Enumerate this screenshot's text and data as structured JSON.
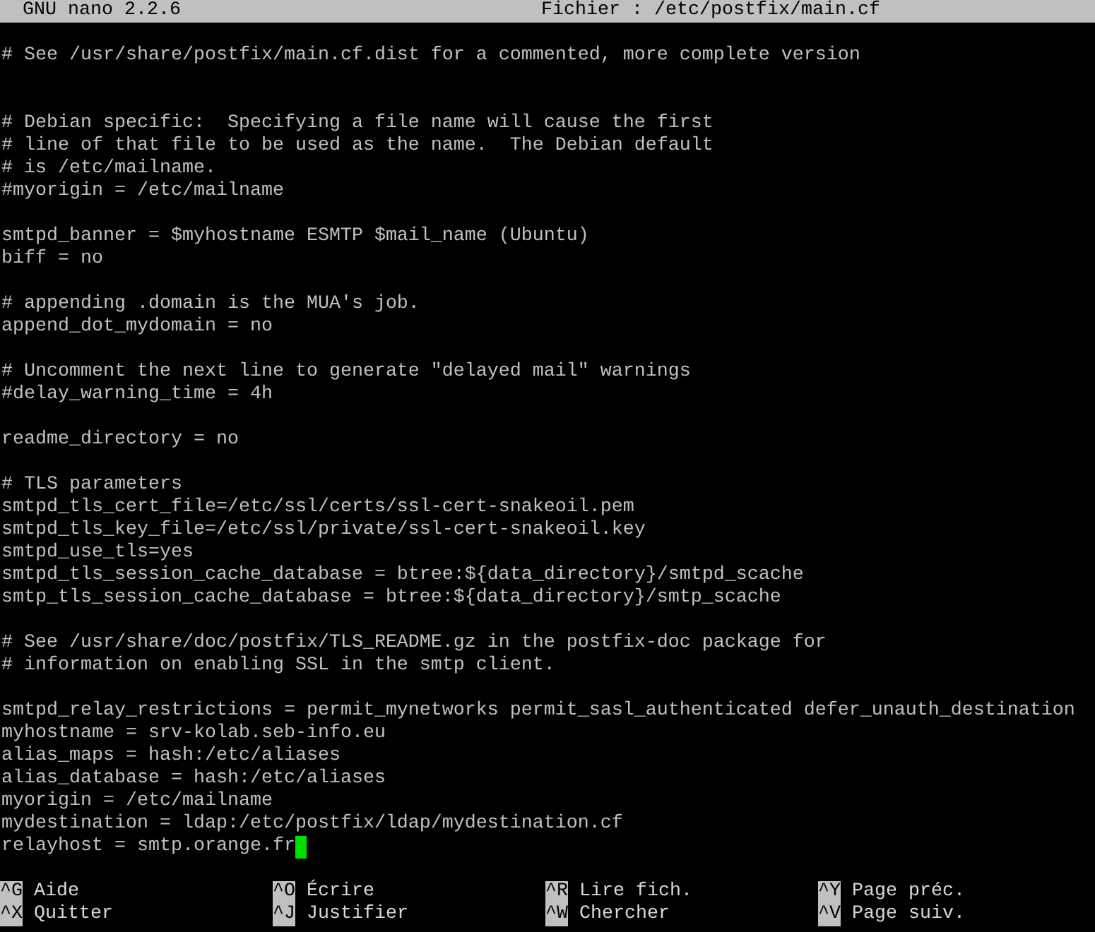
{
  "title_bar": {
    "app": "GNU nano 2.2.6",
    "file": "Fichier : /etc/postfix/main.cf"
  },
  "lines": [
    {
      "kind": "blank"
    },
    {
      "kind": "text",
      "text": "# See /usr/share/postfix/main.cf.dist for a commented, more complete version",
      "cursor": false
    },
    {
      "kind": "blank"
    },
    {
      "kind": "blank"
    },
    {
      "kind": "text",
      "text": "# Debian specific:  Specifying a file name will cause the first",
      "cursor": false
    },
    {
      "kind": "text",
      "text": "# line of that file to be used as the name.  The Debian default",
      "cursor": false
    },
    {
      "kind": "text",
      "text": "# is /etc/mailname.",
      "cursor": false
    },
    {
      "kind": "text",
      "text": "#myorigin = /etc/mailname",
      "cursor": false
    },
    {
      "kind": "blank"
    },
    {
      "kind": "text",
      "text": "smtpd_banner = $myhostname ESMTP $mail_name (Ubuntu)",
      "cursor": false
    },
    {
      "kind": "text",
      "text": "biff = no",
      "cursor": false
    },
    {
      "kind": "blank"
    },
    {
      "kind": "text",
      "text": "# appending .domain is the MUA's job.",
      "cursor": false
    },
    {
      "kind": "text",
      "text": "append_dot_mydomain = no",
      "cursor": false
    },
    {
      "kind": "blank"
    },
    {
      "kind": "text",
      "text": "# Uncomment the next line to generate \"delayed mail\" warnings",
      "cursor": false
    },
    {
      "kind": "text",
      "text": "#delay_warning_time = 4h",
      "cursor": false
    },
    {
      "kind": "blank"
    },
    {
      "kind": "text",
      "text": "readme_directory = no",
      "cursor": false
    },
    {
      "kind": "blank"
    },
    {
      "kind": "text",
      "text": "# TLS parameters",
      "cursor": false
    },
    {
      "kind": "text",
      "text": "smtpd_tls_cert_file=/etc/ssl/certs/ssl-cert-snakeoil.pem",
      "cursor": false
    },
    {
      "kind": "text",
      "text": "smtpd_tls_key_file=/etc/ssl/private/ssl-cert-snakeoil.key",
      "cursor": false
    },
    {
      "kind": "text",
      "text": "smtpd_use_tls=yes",
      "cursor": false
    },
    {
      "kind": "text",
      "text": "smtpd_tls_session_cache_database = btree:${data_directory}/smtpd_scache",
      "cursor": false
    },
    {
      "kind": "text",
      "text": "smtp_tls_session_cache_database = btree:${data_directory}/smtp_scache",
      "cursor": false
    },
    {
      "kind": "blank"
    },
    {
      "kind": "text",
      "text": "# See /usr/share/doc/postfix/TLS_README.gz in the postfix-doc package for",
      "cursor": false
    },
    {
      "kind": "text",
      "text": "# information on enabling SSL in the smtp client.",
      "cursor": false
    },
    {
      "kind": "blank"
    },
    {
      "kind": "text",
      "text": "smtpd_relay_restrictions = permit_mynetworks permit_sasl_authenticated defer_unauth_destination",
      "cursor": false
    },
    {
      "kind": "text",
      "text": "myhostname = srv-kolab.seb-info.eu",
      "cursor": false
    },
    {
      "kind": "text",
      "text": "alias_maps = hash:/etc/aliases",
      "cursor": false
    },
    {
      "kind": "text",
      "text": "alias_database = hash:/etc/aliases",
      "cursor": false
    },
    {
      "kind": "text",
      "text": "myorigin = /etc/mailname",
      "cursor": false
    },
    {
      "kind": "text",
      "text": "mydestination = ldap:/etc/postfix/ldap/mydestination.cf",
      "cursor": false
    },
    {
      "kind": "text",
      "text": "relayhost = smtp.orange.fr",
      "cursor": true
    }
  ],
  "shortcuts": [
    [
      {
        "key": "^G",
        "label": "Aide"
      },
      {
        "key": "^O",
        "label": "Écrire"
      },
      {
        "key": "^R",
        "label": "Lire fich."
      },
      {
        "key": "^Y",
        "label": "Page préc."
      }
    ],
    [
      {
        "key": "^X",
        "label": "Quitter"
      },
      {
        "key": "^J",
        "label": "Justifier"
      },
      {
        "key": "^W",
        "label": "Chercher"
      },
      {
        "key": "^V",
        "label": "Page suiv."
      }
    ]
  ]
}
